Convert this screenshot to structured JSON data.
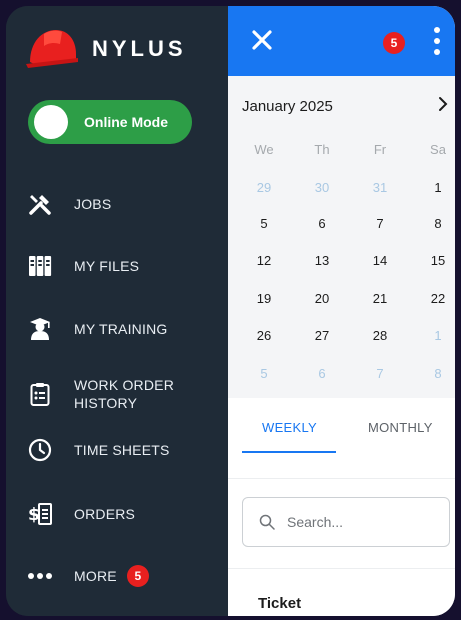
{
  "brand": {
    "name": "NYLUS",
    "logo_icon": "hard-hat-icon",
    "logo_color": "#e8201f"
  },
  "mode_toggle": {
    "label": "Online Mode",
    "on": true,
    "color": "#2d9e47"
  },
  "nav": [
    {
      "id": "jobs",
      "label": "JOBS",
      "icon": "tools-icon"
    },
    {
      "id": "my-files",
      "label": "MY FILES",
      "icon": "binders-icon"
    },
    {
      "id": "my-training",
      "label": "MY TRAINING",
      "icon": "graduate-icon"
    },
    {
      "id": "work-order-history",
      "label": "WORK ORDER\nHISTORY",
      "icon": "clipboard-icon"
    },
    {
      "id": "time-sheets",
      "label": "TIME SHEETS",
      "icon": "clock-icon"
    },
    {
      "id": "orders",
      "label": "ORDERS",
      "icon": "invoice-icon"
    },
    {
      "id": "more",
      "label": "MORE",
      "icon": "more-dots-icon",
      "badge": "5"
    }
  ],
  "topbar": {
    "notification_count": "5",
    "color": "#1877f2"
  },
  "calendar": {
    "month_label": "January 2025",
    "weekdays": [
      "We",
      "Th",
      "Fr",
      "Sa"
    ],
    "weeks": [
      [
        {
          "d": "29",
          "out": true
        },
        {
          "d": "30",
          "out": true
        },
        {
          "d": "31",
          "out": true
        },
        {
          "d": "1",
          "out": false
        }
      ],
      [
        {
          "d": "5",
          "out": false
        },
        {
          "d": "6",
          "out": false
        },
        {
          "d": "7",
          "out": false
        },
        {
          "d": "8",
          "out": false
        }
      ],
      [
        {
          "d": "12",
          "out": false
        },
        {
          "d": "13",
          "out": false
        },
        {
          "d": "14",
          "out": false
        },
        {
          "d": "15",
          "out": false
        }
      ],
      [
        {
          "d": "19",
          "out": false
        },
        {
          "d": "20",
          "out": false
        },
        {
          "d": "21",
          "out": false
        },
        {
          "d": "22",
          "out": false
        }
      ],
      [
        {
          "d": "26",
          "out": false
        },
        {
          "d": "27",
          "out": false
        },
        {
          "d": "28",
          "out": false
        },
        {
          "d": "1",
          "out": true
        }
      ],
      [
        {
          "d": "5",
          "out": true
        },
        {
          "d": "6",
          "out": true
        },
        {
          "d": "7",
          "out": true
        },
        {
          "d": "8",
          "out": true
        }
      ]
    ]
  },
  "view_tabs": {
    "weekly": "WEEKLY",
    "monthly": "MONTHLY",
    "active": "weekly"
  },
  "search": {
    "placeholder": "Search...",
    "value": ""
  },
  "list_header": {
    "ticket": "Ticket"
  }
}
